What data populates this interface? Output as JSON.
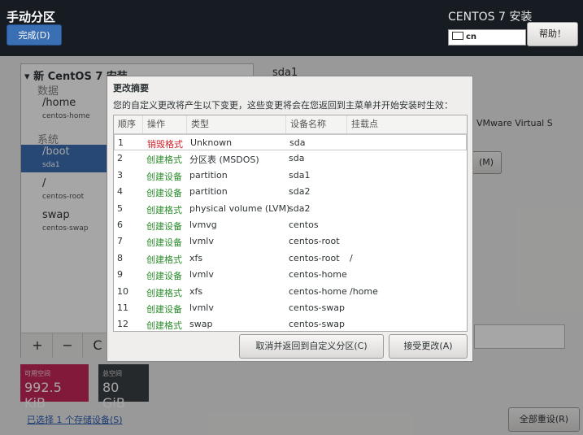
{
  "header": {
    "title": "手动分区",
    "done_button": "完成(D)",
    "install_title": "CENTOS 7 安装",
    "keyboard_layout": "cn",
    "help_button": "帮助！"
  },
  "left_panel": {
    "install_title": "新 CentOS 7 安装",
    "section_data": "数据",
    "section_system": "系统",
    "items": [
      {
        "name": "/home",
        "device": "centos-home"
      },
      {
        "name": "/boot",
        "device": "sda1"
      },
      {
        "name": "/",
        "device": "centos-root"
      },
      {
        "name": "swap",
        "device": "centos-swap"
      }
    ],
    "toolbar": {
      "add": "+",
      "remove": "−",
      "refresh": "C"
    }
  },
  "space": {
    "available_label": "可用空间",
    "available_value": "992.5 KiB",
    "total_label": "总空间",
    "total_value": "80 GiB"
  },
  "footer": {
    "selected_link": "已选择 1 个存储设备(S)",
    "reset_button": "全部重设(R)"
  },
  "right_panel": {
    "device_title": "sda1",
    "device_desc_fragment": "VMware Virtual S",
    "modify_button_fragment": "(M)"
  },
  "dialog": {
    "title": "更改摘要",
    "description": "您的自定义更改将产生以下变更，这些变更将会在您返回到主菜单并开始安装时生效：",
    "columns": [
      "顺序",
      "操作",
      "类型",
      "设备名称",
      "挂载点"
    ],
    "rows": [
      {
        "idx": "1",
        "action": "销毁格式",
        "type": "Unknown",
        "device": "sda",
        "mount": ""
      },
      {
        "idx": "2",
        "action": "创建格式",
        "type": "分区表 (MSDOS)",
        "device": "sda",
        "mount": ""
      },
      {
        "idx": "3",
        "action": "创建设备",
        "type": "partition",
        "device": "sda1",
        "mount": ""
      },
      {
        "idx": "4",
        "action": "创建设备",
        "type": "partition",
        "device": "sda2",
        "mount": ""
      },
      {
        "idx": "5",
        "action": "创建格式",
        "type": "physical volume (LVM)",
        "device": "sda2",
        "mount": ""
      },
      {
        "idx": "6",
        "action": "创建设备",
        "type": "lvmvg",
        "device": "centos",
        "mount": ""
      },
      {
        "idx": "7",
        "action": "创建设备",
        "type": "lvmlv",
        "device": "centos-root",
        "mount": ""
      },
      {
        "idx": "8",
        "action": "创建格式",
        "type": "xfs",
        "device": "centos-root",
        "mount": "/"
      },
      {
        "idx": "9",
        "action": "创建设备",
        "type": "lvmlv",
        "device": "centos-home",
        "mount": ""
      },
      {
        "idx": "10",
        "action": "创建格式",
        "type": "xfs",
        "device": "centos-home",
        "mount": "/home"
      },
      {
        "idx": "11",
        "action": "创建设备",
        "type": "lvmlv",
        "device": "centos-swap",
        "mount": ""
      },
      {
        "idx": "12",
        "action": "创建格式",
        "type": "swap",
        "device": "centos-swap",
        "mount": ""
      }
    ],
    "cancel_button": "取消并返回到自定义分区(C)",
    "accept_button": "接受更改(A)"
  },
  "colors": {
    "accent": "#3c6eb4",
    "create_action": "#2a8c2a",
    "destroy_action": "#d0202a",
    "available_space": "#c7285a"
  }
}
